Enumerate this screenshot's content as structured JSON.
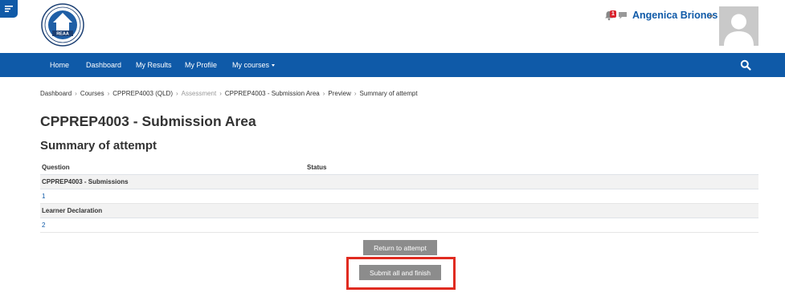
{
  "header": {
    "logo_text": "REAA",
    "notification_count": "1",
    "user_name": "Angenica Briones"
  },
  "nav": {
    "items": [
      {
        "label": "Home"
      },
      {
        "label": "Dashboard"
      },
      {
        "label": "My Results"
      },
      {
        "label": "My Profile"
      },
      {
        "label": "My courses"
      }
    ]
  },
  "breadcrumb": {
    "items": [
      "Dashboard",
      "Courses",
      "CPPREP4003 (QLD)",
      "Assessment",
      "CPPREP4003 - Submission Area",
      "Preview",
      "Summary of attempt"
    ]
  },
  "page": {
    "title": "CPPREP4003 - Submission Area",
    "section_title": "Summary of attempt"
  },
  "table": {
    "headers": [
      "Question",
      "Status"
    ],
    "rows": [
      {
        "type": "group",
        "label": "CPPREP4003 - Submissions"
      },
      {
        "type": "question",
        "number": "1",
        "status": ""
      },
      {
        "type": "group",
        "label": "Learner Declaration"
      },
      {
        "type": "question",
        "number": "2",
        "status": ""
      }
    ]
  },
  "buttons": {
    "return_label": "Return to attempt",
    "submit_label": "Submit all and finish"
  },
  "colors": {
    "brand": "#0f5aa8",
    "button": "#8c8c8c",
    "highlight": "#e02b20"
  },
  "icons": {
    "drawer": "hamburger-icon",
    "notifications": "bell-icon",
    "messages": "chat-bubble-icon",
    "search": "search-icon"
  }
}
